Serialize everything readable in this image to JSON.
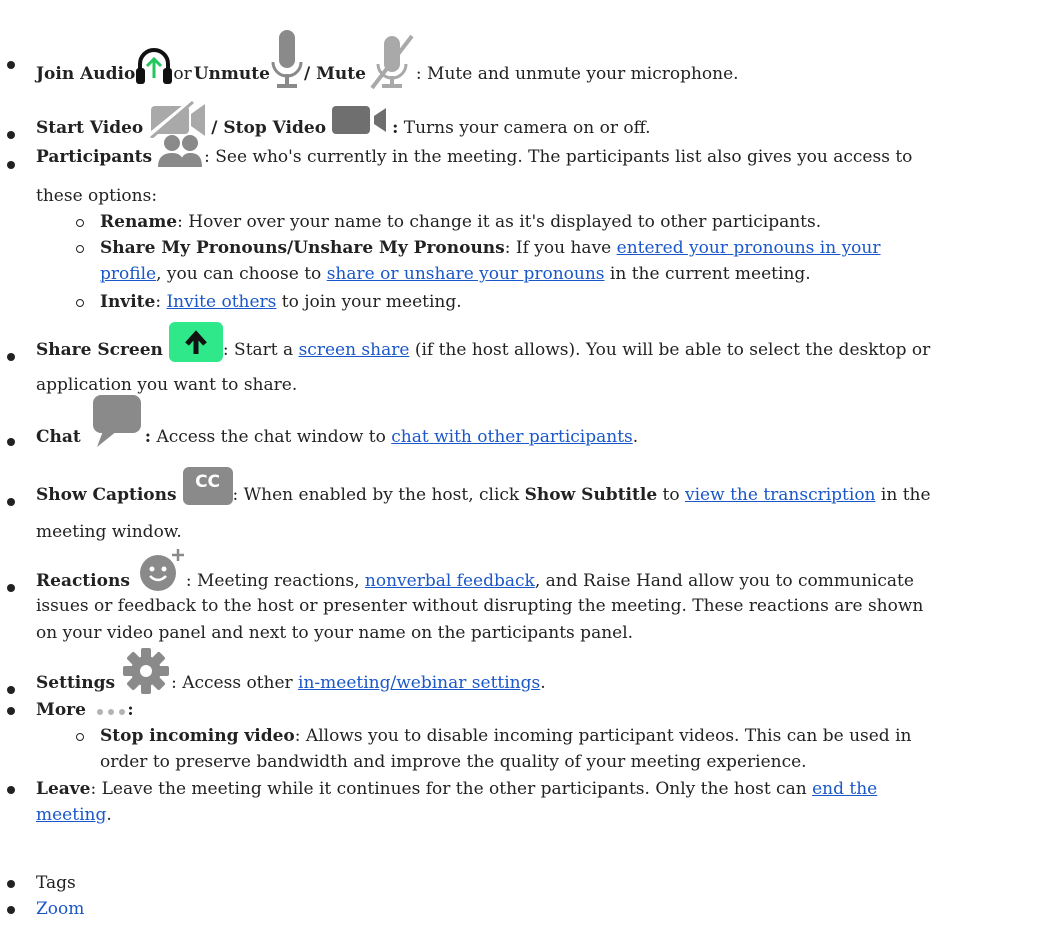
{
  "items": {
    "audio": {
      "join": "Join Audio",
      "or": " or ",
      "unmute": "Unmute",
      "slash_mute": "/ Mute",
      "desc": " : Mute and unmute your microphone."
    },
    "video": {
      "start": "Start Video",
      "slash_stop": "/ Stop Video",
      "colon": ":",
      "desc": " Turns your camera on or off."
    },
    "participants": {
      "label": "Participants",
      "desc1": ": See who's currently in the meeting. The participants list also gives you access to",
      "desc2": "these options:",
      "sub": {
        "rename_label": "Rename",
        "rename_desc": ": Hover over your name to change it as it's displayed to other participants.",
        "pronouns_label": "Share My Pronouns/Unshare My Pronouns",
        "pronouns_desc1": ": If you have ",
        "pronouns_link1a": "entered your pronouns in your",
        "pronouns_link1b": "profile",
        "pronouns_desc2": ", you can choose to ",
        "pronouns_link2": "share or unshare your pronouns",
        "pronouns_desc3": " in the current meeting.",
        "invite_label": "Invite",
        "invite_sep": ": ",
        "invite_link": "Invite others",
        "invite_desc": " to join your meeting."
      }
    },
    "share": {
      "label": "Share Screen",
      "desc1": ": Start a ",
      "link": "screen share",
      "desc2": " (if the host allows). You will be able to select the desktop or",
      "desc3": "application you want to share."
    },
    "chat": {
      "label": "Chat",
      "colon": ":",
      "desc1": " Access the chat window to ",
      "link": "chat with other participants",
      "desc2": "."
    },
    "captions": {
      "label": "Show Captions",
      "cc": "CC",
      "desc1": ": When enabled by the host, click ",
      "bold": "Show Subtitle",
      "desc2": " to ",
      "link": "view the transcription",
      "desc3": " in the",
      "desc4": "meeting window."
    },
    "reactions": {
      "label": "Reactions",
      "desc1": " : Meeting reactions, ",
      "link": "nonverbal feedback",
      "desc2": ", and Raise Hand allow you to communicate",
      "desc3": "issues or feedback to the host or presenter without disrupting the meeting. These reactions are shown",
      "desc4": "on your video panel and next to your name on the participants panel."
    },
    "settings": {
      "label": "Settings",
      "desc1": ": Access other ",
      "link": "in-meeting/webinar settings",
      "desc2": "."
    },
    "more": {
      "label": "More",
      "colon": ":",
      "sub_label": "Stop incoming video",
      "sub_desc1": ": Allows you to disable incoming participant videos. This can be used in",
      "sub_desc2": "order to preserve bandwidth and improve the quality of your meeting experience."
    },
    "leave": {
      "label": "Leave",
      "desc1": ": Leave the meeting while it continues for the other participants. Only the host can ",
      "link1": "end the",
      "link2": "meeting",
      "desc2": "."
    }
  },
  "tags": {
    "label": "Tags",
    "zoom": "Zoom"
  },
  "colors": {
    "link": "#1a57c9",
    "icon_gray": "#8a8a8a",
    "icon_green": "#2ee88a",
    "arrow_green": "#22c55e"
  }
}
